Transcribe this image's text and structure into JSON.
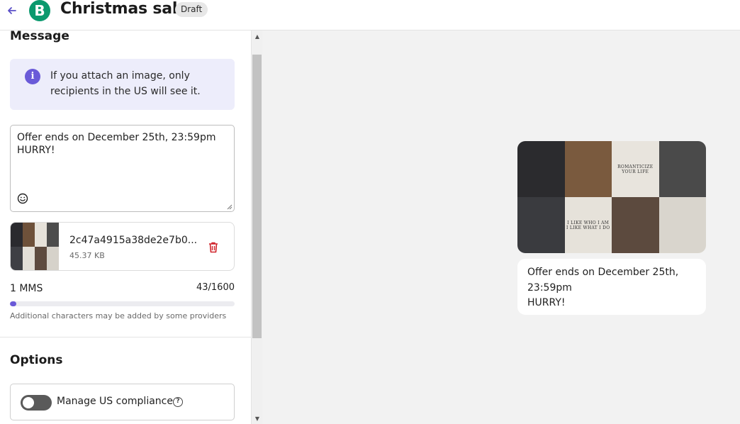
{
  "header": {
    "title": "Christmas sale",
    "badge": "Draft",
    "logo_letter": "B",
    "logo_color": "#0b996e"
  },
  "message": {
    "section_title": "Message",
    "info_text": "If you attach an image, only recipients in the US will see it.",
    "body": "Offer ends on December 25th, 23:59pm\nHURRY!",
    "attachment": {
      "file_name": "2c47a4915a38de2e7b0...",
      "file_size": "45.37 KB"
    },
    "mms_count": "1 MMS",
    "char_count": "43/1600",
    "progress_fraction": 0.027,
    "hint": "Additional characters may be added by some providers",
    "accent_color": "#6a5ad8"
  },
  "options": {
    "section_title": "Options",
    "compliance_label": "Manage US compliance",
    "compliance_enabled": false
  },
  "preview": {
    "image_tiles": [
      {
        "bg": "#2b2b2e",
        "caption": ""
      },
      {
        "bg": "#7a5a3e",
        "caption": ""
      },
      {
        "bg": "#e8e4dd",
        "caption": "ROMANTICIZE\nYOUR LIFE"
      },
      {
        "bg": "#4a4a4a",
        "caption": ""
      },
      {
        "bg": "#3a3b3f",
        "caption": ""
      },
      {
        "bg": "#e6e2da",
        "caption": "I LIKE WHO I AM\nI LIKE WHAT I DO"
      },
      {
        "bg": "#5c4a3e",
        "caption": ""
      },
      {
        "bg": "#d9d5cd",
        "caption": ""
      }
    ],
    "bubble_text": "Offer ends on December 25th, 23:59pm\nHURRY!"
  },
  "icons": {
    "back": "arrow-left-icon",
    "info": "info-icon",
    "emoji": "emoji-icon",
    "delete": "trash-icon",
    "help": "question-circle-icon"
  }
}
